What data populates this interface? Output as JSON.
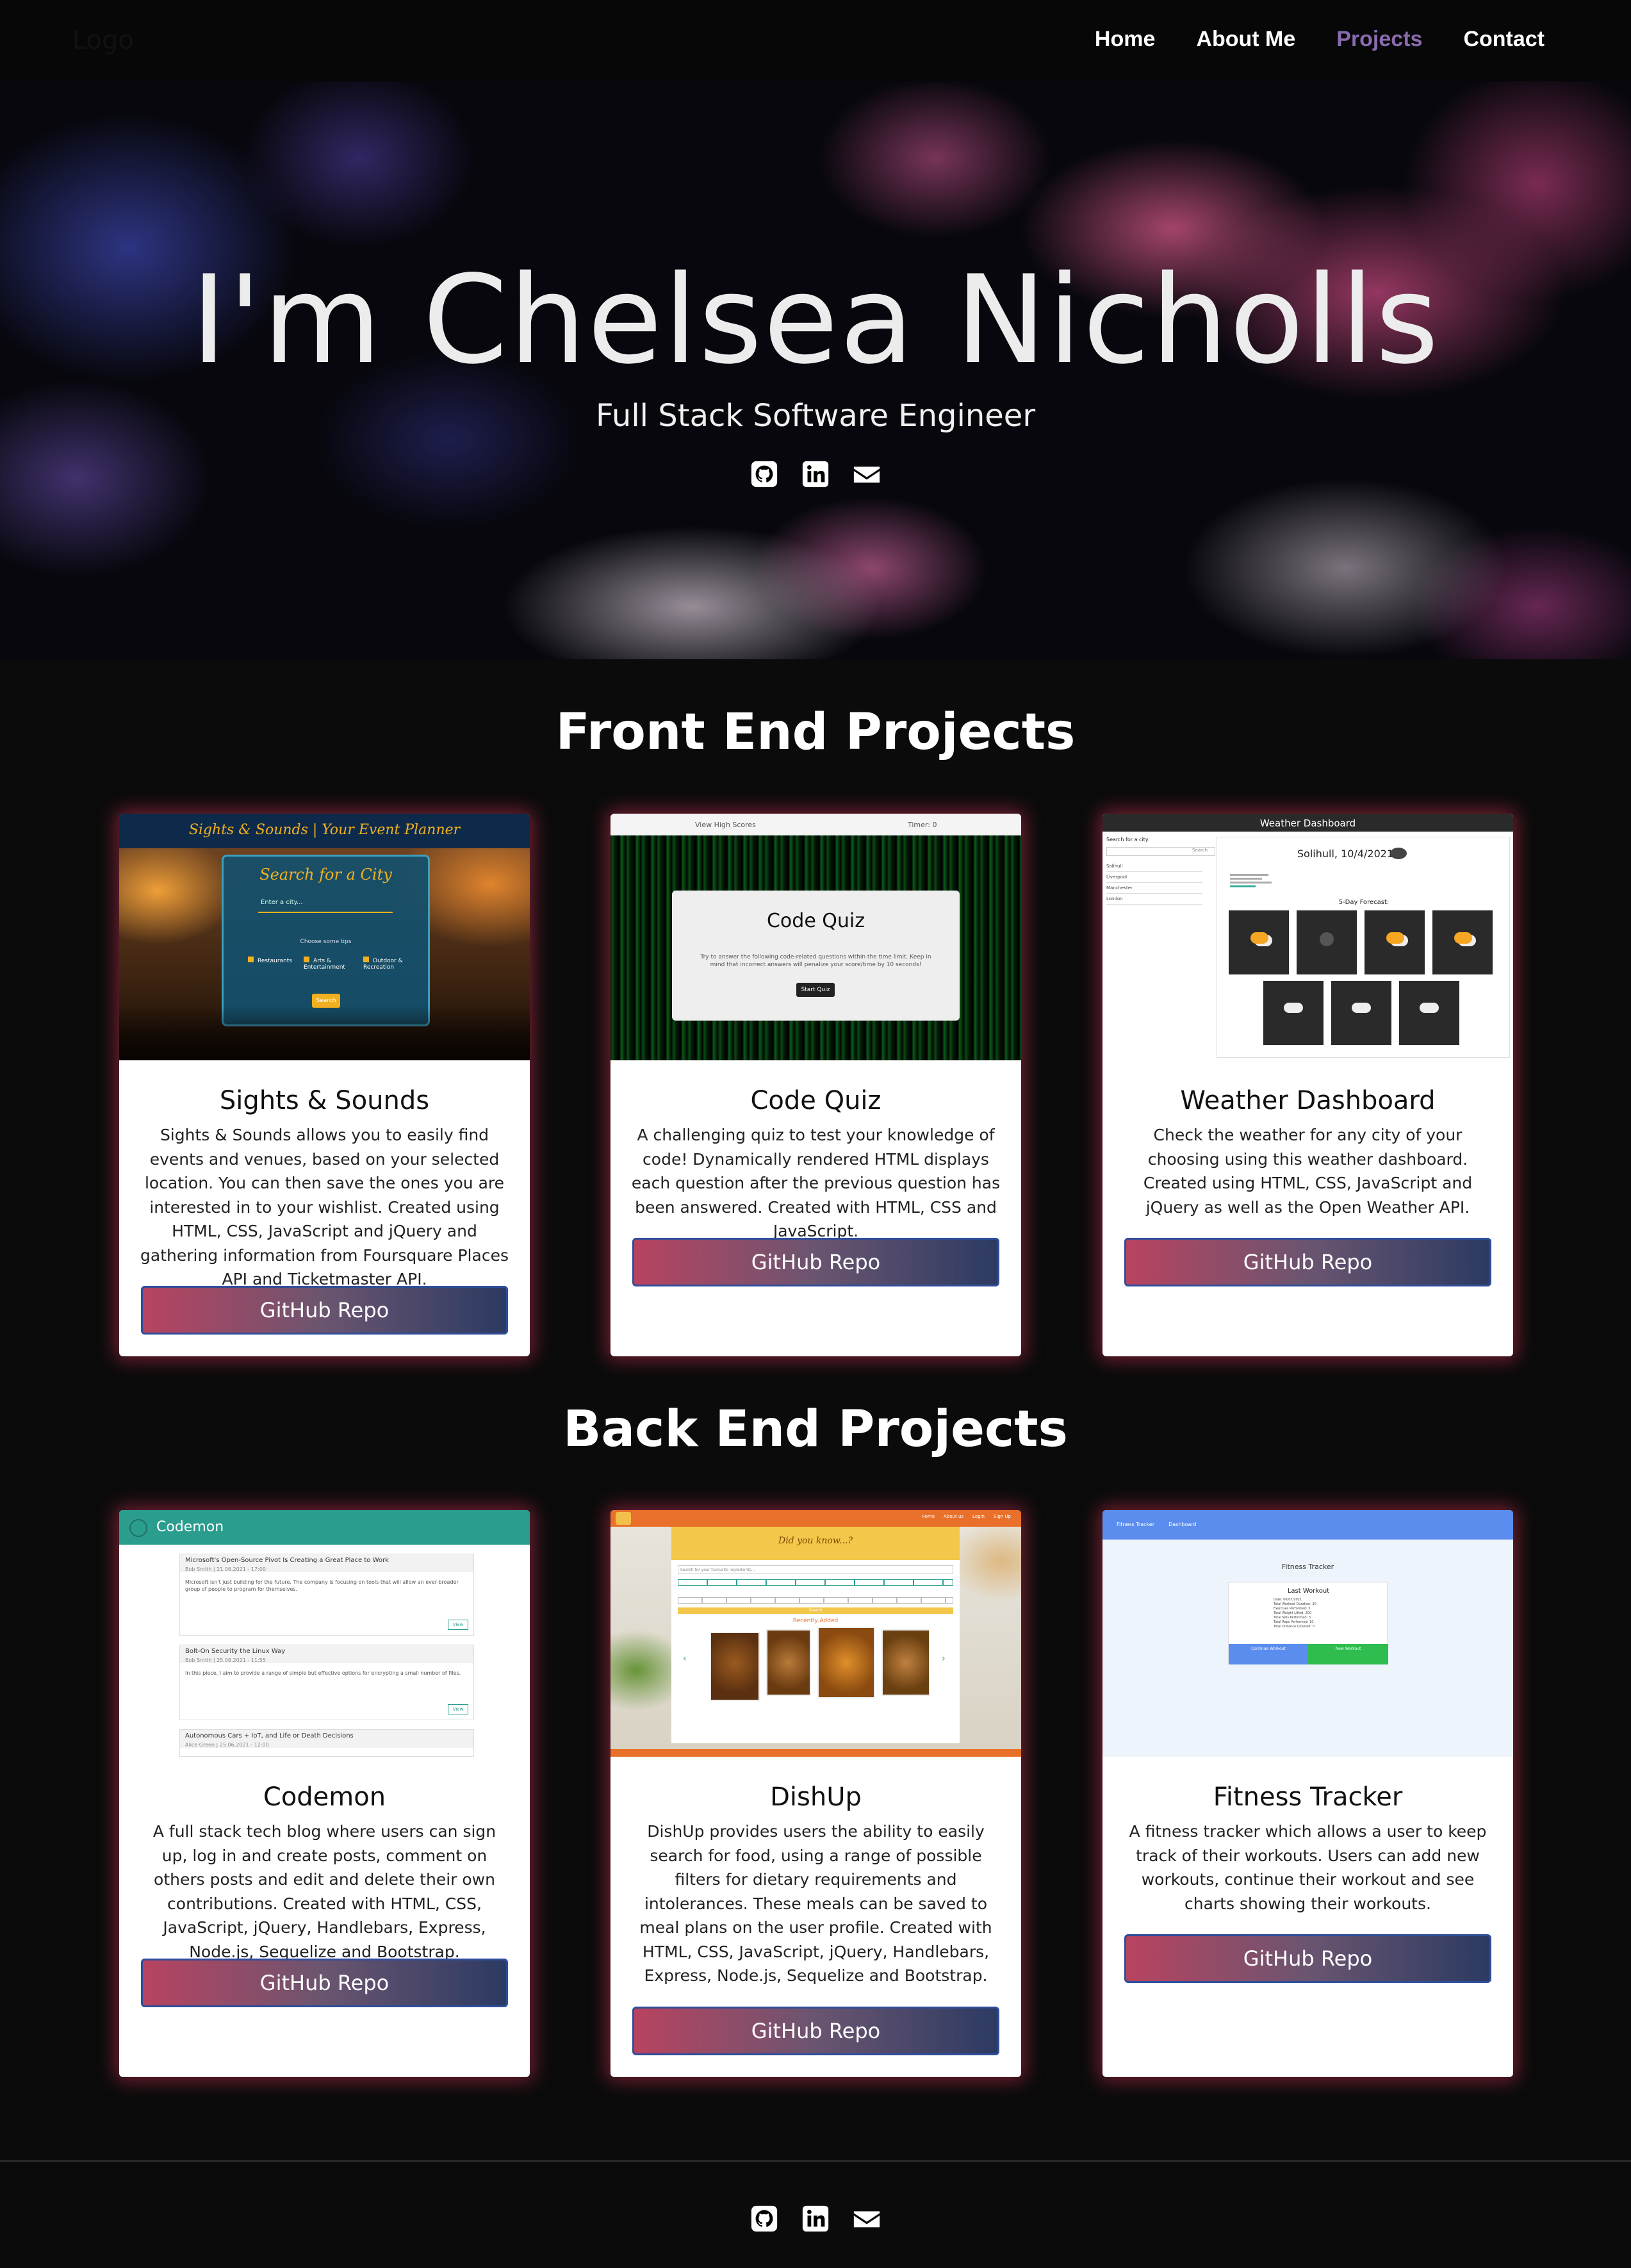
{
  "nav": {
    "logo": "Logo",
    "links": [
      {
        "label": "Home",
        "active": false
      },
      {
        "label": "About Me",
        "active": false
      },
      {
        "label": "Projects",
        "active": true
      },
      {
        "label": "Contact",
        "active": false
      }
    ]
  },
  "hero": {
    "title": "I'm Chelsea Nicholls",
    "subtitle": "Full Stack Software Engineer",
    "icons": [
      "github-icon",
      "linkedin-icon",
      "envelope-icon"
    ]
  },
  "sections": {
    "front_end": "Front End Projects",
    "back_end": "Back End Projects"
  },
  "button_label": "GitHub Repo",
  "projects": [
    {
      "title": "Sights & Sounds",
      "description": "Sights & Sounds allows you to easily find events and venues, based on your selected location. You can then save the ones you are interested in to your wishlist. Created using HTML, CSS, JavaScript and jQuery and gathering information from Foursquare Places API and Ticketmaster API.",
      "screenshot": {
        "header": "Sights & Sounds | Your Event Planner",
        "search_heading": "Search for a City",
        "input_placeholder": "Enter a city...",
        "prompt": "Choose some tips",
        "options": [
          "Restaurants",
          "Arts & Entertainment",
          "Outdoor & Recreation"
        ],
        "button": "Search"
      }
    },
    {
      "title": "Code Quiz",
      "description": "A challenging quiz to test your knowledge of code! Dynamically rendered HTML displays each question after the previous question has been answered. Created with HTML, CSS and JavaScript.",
      "screenshot": {
        "top_left": "View High Scores",
        "top_right": "Timer: 0",
        "heading": "Code Quiz",
        "body": "Try to answer the following code-related questions within the time limit. Keep in mind that incorrect answers will penalize your score/time by 10 seconds!",
        "button": "Start Quiz"
      }
    },
    {
      "title": "Weather Dashboard",
      "description": "Check the weather for any city of your choosing using this weather dashboard. Created using HTML, CSS, JavaScript and jQuery as well as the Open Weather API.",
      "screenshot": {
        "header": "Weather Dashboard",
        "search_label": "Search for a city:",
        "search_button": "Search",
        "cities": [
          "Solihull",
          "Liverpool",
          "Manchester",
          "London"
        ],
        "current": "Solihull, 10/4/2021",
        "forecast_heading": "5-Day Forecast:"
      }
    },
    {
      "title": "Codemon",
      "description": "A full stack tech blog where users can sign up, log in and create posts, comment on others posts and edit and delete their own contributions. Created with HTML, CSS, JavaScript, jQuery, Handlebars, Express, Node.js, Sequelize and Bootstrap.",
      "screenshot": {
        "brand": "Codemon",
        "posts": [
          {
            "title": "Microsoft's Open-Source Pivot Is Creating a Great Place to Work",
            "meta": "Bob Smith | 21.06.2021 - 17:00",
            "body": "Microsoft isn't just building for the future. The company is focusing on tools that will allow an ever-broader group of people to program for themselves."
          },
          {
            "title": "Bolt-On Security the Linux Way",
            "meta": "Bob Smith | 25.06.2021 - 11:55",
            "body": "In this piece, I aim to provide a range of simple but effective options for encrypting a small number of files."
          },
          {
            "title": "Autonomous Cars + IoT, and Life or Death Decisions",
            "meta": "Alice Green | 25.06.2021 - 12:00",
            "body": ""
          }
        ],
        "view_label": "View"
      }
    },
    {
      "title": "DishUp",
      "description": "DishUp provides users the ability to easily search for food, using a range of possible filters for dietary requirements and intolerances. These meals can be saved to meal plans on the user profile. Created with HTML, CSS, JavaScript, jQuery, Handlebars, Express, Node.js, Sequelize and Bootstrap.",
      "screenshot": {
        "banner": "Did you know...?",
        "search_placeholder": "Search for your favourite ingredients...",
        "recent_label": "Recently Added",
        "nav": [
          "Home",
          "About us",
          "Login",
          "Sign Up"
        ],
        "search_button": "Search"
      }
    },
    {
      "title": "Fitness Tracker",
      "description": "A fitness tracker which allows a user to keep track of their workouts. Users can add new workouts, continue their workout and see charts showing their workouts.",
      "screenshot": {
        "nav": [
          "Fitness Tracker",
          "Dashboard"
        ],
        "heading": "Fitness Tracker",
        "card_title": "Last Workout",
        "rows": [
          "Date: 06/07/2021",
          "Total Workout Duration: 30",
          "Exercises Performed: 3",
          "Total Weight Lifted: 200",
          "Total Sets Performed: 3",
          "Total Reps Performed: 10",
          "Total Distance Covered: 0"
        ],
        "continue_button": "Continue Workout",
        "new_button": "New Workout"
      }
    }
  ],
  "colors": {
    "accent_purple": "#8a6bb0",
    "card_glow": "#c83250",
    "button_gradient_start": "#b84360",
    "button_gradient_end": "#2c3a62",
    "codemon_teal": "#2a9d8f",
    "dishup_orange": "#e8702a",
    "fitness_blue": "#5b8def",
    "fitness_green": "#2ebd4e"
  }
}
